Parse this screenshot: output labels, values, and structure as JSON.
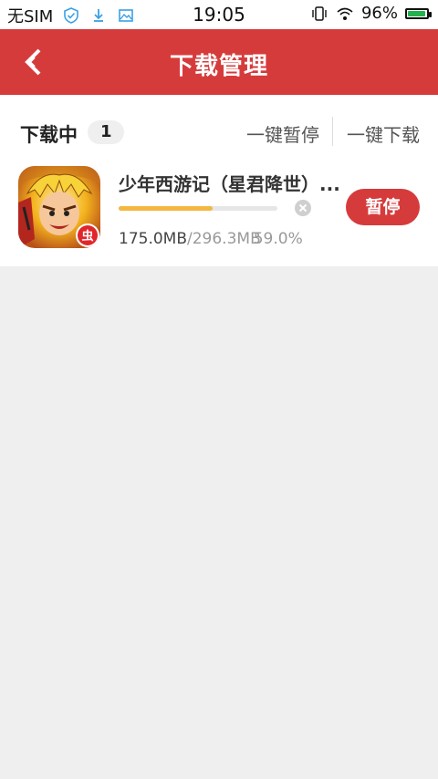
{
  "status_bar": {
    "carrier": "无SIM",
    "time": "19:05",
    "battery_text": "96%",
    "battery_level": 0.96,
    "icons": [
      "shield-check-icon",
      "download-arrow-icon",
      "image-icon",
      "vibrate-icon",
      "wifi-icon",
      "battery-icon"
    ]
  },
  "header": {
    "title": "下载管理",
    "background": "#d63b3c"
  },
  "downloads": {
    "section_title": "下载中",
    "count": "1",
    "pause_all": "一键暂停",
    "download_all": "一键下载",
    "items": [
      {
        "name": "少年西游记（星君降世）...",
        "downloaded": "175.0MB",
        "total": "/296.3MB",
        "percent_text": "59.0%",
        "progress": 0.59,
        "pause_label": "暂停",
        "icon": "app-game-icon"
      }
    ]
  },
  "colors": {
    "accent": "#d63b3c",
    "progress": "#f4b740",
    "background": "#efefef"
  }
}
